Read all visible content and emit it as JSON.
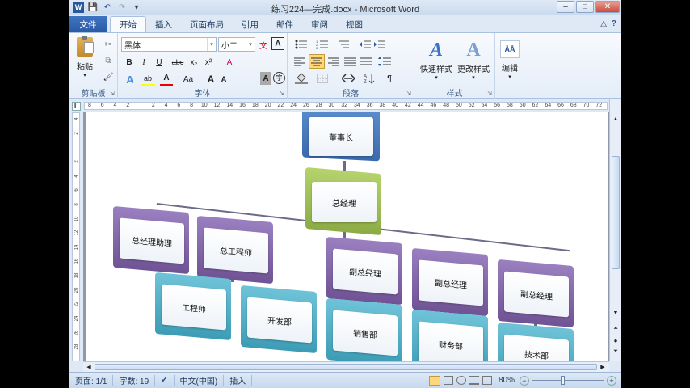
{
  "window": {
    "title": "练习224—完成.docx - Microsoft Word",
    "minimize": "–",
    "maximize": "□",
    "close": "✕"
  },
  "qat": {
    "word_logo": "W",
    "save": "💾",
    "undo": "↶",
    "redo": "↷",
    "customize": "▾"
  },
  "tabs": [
    {
      "label": "文件"
    },
    {
      "label": "开始"
    },
    {
      "label": "插入"
    },
    {
      "label": "页面布局"
    },
    {
      "label": "引用"
    },
    {
      "label": "邮件"
    },
    {
      "label": "审阅"
    },
    {
      "label": "视图"
    }
  ],
  "tabs_right": {
    "collapse": "△",
    "help": "?"
  },
  "clipboard": {
    "paste_label": "粘贴",
    "group_label": "剪贴板",
    "cut": "✂",
    "copy": "⧉",
    "format_painter": "🖌",
    "dropdown": "▾",
    "launcher": "⇲"
  },
  "font": {
    "name": "黑体",
    "size": "小二",
    "group_label": "字体",
    "bold": "B",
    "italic": "I",
    "underline": "U",
    "strike": "abc",
    "subscript": "x₂",
    "superscript": "x²",
    "grow": "A",
    "shrink": "A",
    "clear": "A",
    "phonetic": "文",
    "border_char": "A",
    "effects": "A",
    "highlight": "ab",
    "color": "A",
    "case": "Aa",
    "shading": "A",
    "enclose": "字",
    "launcher": "⇲"
  },
  "paragraph": {
    "group_label": "段落",
    "launcher": "⇲"
  },
  "styles": {
    "group_label": "样式",
    "quick": "快速样式",
    "change": "更改样式",
    "launcher": "⇲"
  },
  "editing": {
    "label": "编辑"
  },
  "ruler": {
    "ticks": [
      "L",
      "8",
      "6",
      "4",
      "2",
      "",
      "2",
      "4",
      "6",
      "8",
      "10",
      "12",
      "14",
      "16",
      "18",
      "20",
      "22",
      "24",
      "26",
      "28",
      "30",
      "32",
      "34",
      "36",
      "38",
      "40",
      "42",
      "44",
      "46",
      "48",
      "50",
      "52",
      "54",
      "56",
      "58",
      "60",
      "62",
      "64",
      "66",
      "68",
      "70",
      "72"
    ]
  },
  "vruler": {
    "ticks": [
      "4",
      "2",
      "",
      "2",
      "4",
      "6",
      "8",
      "10",
      "12",
      "14",
      "16",
      "18",
      "20",
      "22",
      "24",
      "26",
      "28"
    ]
  },
  "org": {
    "chairman": "董事长",
    "gm": "总经理",
    "gm_assistant": "总经理助理",
    "chief_engineer": "总工程师",
    "vp1": "副总经理",
    "vp2": "副总经理",
    "vp3": "副总经理",
    "engineer": "工程师",
    "dev": "开发部",
    "sales": "销售部",
    "finance": "财务部",
    "tech": "技术部"
  },
  "colors": {
    "blue": "#4f81bd",
    "green": "#9bbb59",
    "purple": "#8064a2",
    "teal": "#4bacc6"
  },
  "status": {
    "page": "页面: 1/1",
    "words": "字数: 19",
    "lang": "中文(中国)",
    "mode": "插入",
    "zoom": "80%",
    "zoom_minus": "−",
    "zoom_plus": "+"
  }
}
